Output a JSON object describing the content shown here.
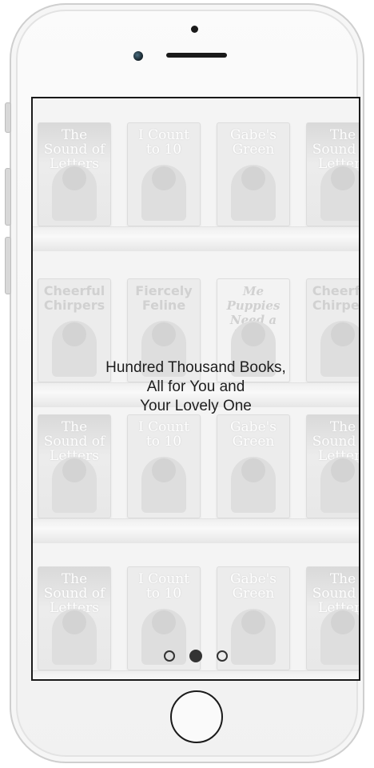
{
  "device": {
    "body_color": "#f4f4f4",
    "frame_stroke": "#1a1a1a"
  },
  "onboarding": {
    "tagline_lines": [
      "Hundred Thousand Books,",
      "All for You and",
      "Your Lovely One"
    ],
    "carousel": {
      "page_count": 3,
      "active_index": 1
    }
  },
  "bookshelf": {
    "rows": [
      {
        "books": [
          {
            "title": "The Sound of Letters"
          },
          {
            "title": "I Count to 10"
          },
          {
            "title": "Gabe's Green"
          },
          {
            "title": "The Sound of Letters"
          }
        ]
      },
      {
        "books": [
          {
            "title": "Cheerful Chirpers"
          },
          {
            "title": "Fiercely Feline"
          },
          {
            "title": "Me Puppies Need a Home"
          },
          {
            "title": "Cheerful Chirpers"
          }
        ]
      },
      {
        "books": [
          {
            "title": "The Sound of Letters"
          },
          {
            "title": "I Count to 10"
          },
          {
            "title": "Gabe's Green"
          },
          {
            "title": "The Sound of Letters"
          }
        ]
      },
      {
        "books": [
          {
            "title": "The Sound of Letters"
          },
          {
            "title": "I Count to 10"
          },
          {
            "title": "Gabe's Green"
          },
          {
            "title": "The Sound of Letters"
          }
        ]
      }
    ]
  }
}
